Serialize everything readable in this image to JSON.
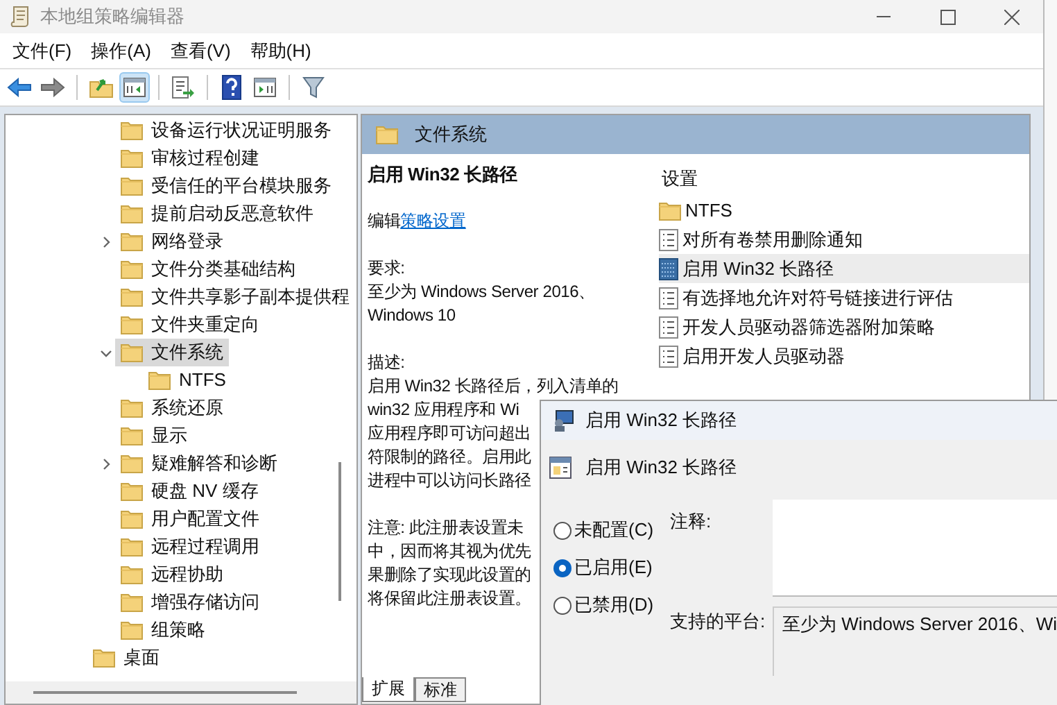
{
  "window": {
    "title": "本地组策略编辑器"
  },
  "menu": [
    "文件(F)",
    "操作(A)",
    "查看(V)",
    "帮助(H)"
  ],
  "toolbar": [
    {
      "kind": "back"
    },
    {
      "kind": "forward"
    },
    {
      "kind": "sep"
    },
    {
      "kind": "up"
    },
    {
      "kind": "pane",
      "selected": true
    },
    {
      "kind": "sep"
    },
    {
      "kind": "export"
    },
    {
      "kind": "sep"
    },
    {
      "kind": "help"
    },
    {
      "kind": "view"
    },
    {
      "kind": "sep"
    },
    {
      "kind": "filter"
    }
  ],
  "tree": [
    {
      "children": [
        {
          "label": "设备运行状况证明服务",
          "selected": false
        },
        {
          "label": "审核过程创建",
          "selected": false
        },
        {
          "label": "受信任的平台模块服务",
          "selected": false
        },
        {
          "label": "提前启动反恶意软件",
          "selected": false
        },
        {
          "label": "网络登录",
          "selected": false,
          "expanded": false
        },
        {
          "label": "文件分类基础结构",
          "selected": false
        },
        {
          "label": "文件共享影子副本提供程",
          "selected": false
        },
        {
          "label": "文件夹重定向",
          "selected": false
        },
        {
          "label": "文件系统",
          "selected": true,
          "expanded": true,
          "children": [
            {
              "label": "NTFS",
              "selected": false
            }
          ]
        },
        {
          "label": "系统还原",
          "selected": false
        },
        {
          "label": "显示",
          "selected": false
        },
        {
          "label": "疑难解答和诊断",
          "selected": false,
          "expanded": false
        },
        {
          "label": "硬盘 NV 缓存",
          "selected": false
        },
        {
          "label": "用户配置文件",
          "selected": false
        },
        {
          "label": "远程过程调用",
          "selected": false
        },
        {
          "label": "远程协助",
          "selected": false
        },
        {
          "label": "增强存储访问",
          "selected": false
        },
        {
          "label": "组策略",
          "selected": false
        }
      ]
    },
    {
      "label": "桌面",
      "selected": false
    }
  ],
  "details": {
    "header": "文件系统",
    "title": "启用 Win32 长路径",
    "edit_prefix": "编辑",
    "edit_link": "策略设置",
    "requirements_label": "要求:",
    "requirements": [
      "至少为 Windows Server 2016、",
      "Windows 10"
    ],
    "description_label": "描述:",
    "description": [
      "启用 Win32 长路径后，列入清单的",
      "win32 应用程序和 Wi",
      "应用程序即可访问超出",
      "符限制的路径。启用此",
      "进程中可以访问长路径"
    ],
    "note": [
      "注意: 此注册表设置未",
      "中，因而将其视为优先",
      "果删除了实现此设置的",
      "将保留此注册表设置。"
    ],
    "tabs": [
      {
        "label": "扩展",
        "selected": true
      },
      {
        "label": "标准",
        "selected": false
      }
    ]
  },
  "settings": {
    "header": "设置",
    "items": [
      {
        "kind": "folder",
        "label": "NTFS",
        "selected": false
      },
      {
        "kind": "policy",
        "label": "对所有卷禁用删除通知",
        "selected": false
      },
      {
        "kind": "policy",
        "label": "启用 Win32 长路径",
        "selected": true
      },
      {
        "kind": "policy",
        "label": "有选择地允许对符号链接进行评估",
        "selected": false
      },
      {
        "kind": "policy",
        "label": "开发人员驱动器筛选器附加策略",
        "selected": false
      },
      {
        "kind": "policy",
        "label": "启用开发人员驱动器",
        "selected": false
      }
    ]
  },
  "dialog": {
    "title": "启用 Win32 长路径",
    "heading": "启用 Win32 长路径",
    "options": [
      {
        "label": "未配置(C)",
        "selected": false
      },
      {
        "label": "已启用(E)",
        "selected": true
      },
      {
        "label": "已禁用(D)",
        "selected": false
      }
    ],
    "comment_label": "注释:",
    "platform_label": "支持的平台:",
    "platform": "至少为 Windows Server 2016、Wi"
  }
}
